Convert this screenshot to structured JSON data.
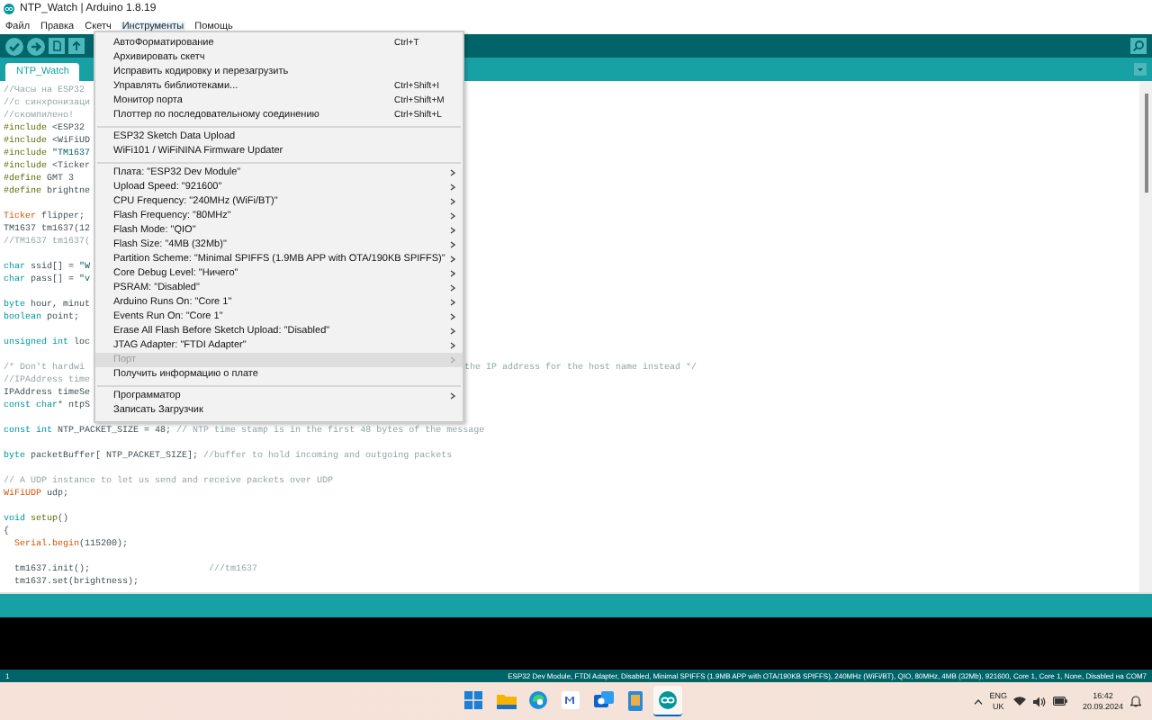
{
  "window": {
    "title": "NTP_Watch | Arduino 1.8.19"
  },
  "menu_bar": [
    {
      "label": "Файл",
      "selected": false
    },
    {
      "label": "Правка",
      "selected": false
    },
    {
      "label": "Скетч",
      "selected": false
    },
    {
      "label": "Инструменты",
      "selected": true
    },
    {
      "label": "Помощь",
      "selected": false
    }
  ],
  "tabs": [
    {
      "label": "NTP_Watch",
      "selected": true
    }
  ],
  "editor": {
    "lines": [
      {
        "kind": "code",
        "segments": [
          {
            "text": "//Часы на ESP32",
            "kind": "comment"
          }
        ]
      },
      {
        "kind": "code",
        "segments": [
          {
            "text": "//с синхронизаци",
            "kind": "comment"
          }
        ]
      },
      {
        "kind": "code",
        "segments": [
          {
            "text": "//скомпилено!",
            "kind": "comment"
          }
        ]
      },
      {
        "kind": "code",
        "segments": [
          {
            "text": "#include",
            "kind": "directive"
          },
          {
            "text": " <ESP32",
            "kind": "plain"
          }
        ]
      },
      {
        "kind": "code",
        "segments": [
          {
            "text": "#include",
            "kind": "directive"
          },
          {
            "text": " <WiFiUD",
            "kind": "plain"
          }
        ]
      },
      {
        "kind": "code",
        "segments": [
          {
            "text": "#include",
            "kind": "directive"
          },
          {
            "text": " \"TM1637",
            "kind": "string"
          }
        ]
      },
      {
        "kind": "code",
        "segments": [
          {
            "text": "#include",
            "kind": "directive"
          },
          {
            "text": " <Ticker",
            "kind": "plain"
          }
        ]
      },
      {
        "kind": "code",
        "segments": [
          {
            "text": "#define",
            "kind": "directive"
          },
          {
            "text": " GMT 3",
            "kind": "plain"
          }
        ]
      },
      {
        "kind": "code",
        "segments": [
          {
            "text": "#define",
            "kind": "directive"
          },
          {
            "text": " brightne",
            "kind": "plain"
          }
        ]
      },
      {
        "kind": "blank"
      },
      {
        "kind": "code",
        "segments": [
          {
            "text": "Ticker",
            "kind": "class"
          },
          {
            "text": " flipper;",
            "kind": "plain"
          }
        ]
      },
      {
        "kind": "code",
        "segments": [
          {
            "text": "TM1637 tm1637(12",
            "kind": "plain"
          }
        ]
      },
      {
        "kind": "code",
        "segments": [
          {
            "text": "//TM1637 tm1637(",
            "kind": "comment"
          }
        ]
      },
      {
        "kind": "blank"
      },
      {
        "kind": "code",
        "segments": [
          {
            "text": "char",
            "kind": "keyword"
          },
          {
            "text": " ssid[] = ",
            "kind": "plain"
          },
          {
            "text": "\"W",
            "kind": "string"
          }
        ]
      },
      {
        "kind": "code",
        "segments": [
          {
            "text": "char",
            "kind": "keyword"
          },
          {
            "text": " pass[] = ",
            "kind": "plain"
          },
          {
            "text": "\"v",
            "kind": "string"
          }
        ]
      },
      {
        "kind": "blank"
      },
      {
        "kind": "code",
        "segments": [
          {
            "text": "byte",
            "kind": "keyword"
          },
          {
            "text": " hour, minut",
            "kind": "plain"
          }
        ]
      },
      {
        "kind": "code",
        "segments": [
          {
            "text": "boolean",
            "kind": "keyword"
          },
          {
            "text": " point;",
            "kind": "plain"
          }
        ]
      },
      {
        "kind": "blank"
      },
      {
        "kind": "code",
        "segments": [
          {
            "text": "unsigned int",
            "kind": "keyword"
          },
          {
            "text": " loc",
            "kind": "plain"
          }
        ]
      },
      {
        "kind": "blank"
      },
      {
        "kind": "code",
        "segments": [
          {
            "text": "/* Don't hardwi",
            "kind": "comment"
          }
        ],
        "tail": "the IP address for the host name instead */"
      },
      {
        "kind": "code",
        "segments": [
          {
            "text": "//IPAddress time",
            "kind": "comment"
          }
        ]
      },
      {
        "kind": "code",
        "segments": [
          {
            "text": "IPAddress timeSe",
            "kind": "plain"
          }
        ]
      },
      {
        "kind": "code",
        "segments": [
          {
            "text": "const",
            "kind": "keyword"
          },
          {
            "text": " char",
            "kind": "keyword"
          },
          {
            "text": "* ntpS",
            "kind": "plain"
          }
        ]
      },
      {
        "kind": "blank"
      },
      {
        "kind": "code",
        "segments": [
          {
            "text": "const",
            "kind": "keyword"
          },
          {
            "text": " int",
            "kind": "keyword"
          },
          {
            "text": " NTP_PACKET_SIZE = 48; ",
            "kind": "plain"
          },
          {
            "text": "// NTP time stamp is in the first 48 bytes of the message",
            "kind": "comment"
          }
        ]
      },
      {
        "kind": "blank"
      },
      {
        "kind": "code",
        "segments": [
          {
            "text": "byte",
            "kind": "keyword"
          },
          {
            "text": " packetBuffer[ NTP_PACKET_SIZE]; ",
            "kind": "plain"
          },
          {
            "text": "//buffer to hold incoming and outgoing packets",
            "kind": "comment"
          }
        ]
      },
      {
        "kind": "blank"
      },
      {
        "kind": "code",
        "segments": [
          {
            "text": "// A UDP instance to let us send and receive packets over UDP",
            "kind": "comment"
          }
        ]
      },
      {
        "kind": "code",
        "segments": [
          {
            "text": "WiFiUDP",
            "kind": "class"
          },
          {
            "text": " udp;",
            "kind": "plain"
          }
        ]
      },
      {
        "kind": "blank"
      },
      {
        "kind": "code",
        "segments": [
          {
            "text": "void",
            "kind": "keyword"
          },
          {
            "text": " setup",
            "kind": "directive"
          },
          {
            "text": "()",
            "kind": "plain"
          }
        ]
      },
      {
        "kind": "code",
        "segments": [
          {
            "text": "{",
            "kind": "plain"
          }
        ]
      },
      {
        "kind": "code",
        "segments": [
          {
            "text": "  Serial",
            "kind": "class"
          },
          {
            "text": ".",
            "kind": "plain"
          },
          {
            "text": "begin",
            "kind": "class"
          },
          {
            "text": "(115200);",
            "kind": "plain"
          }
        ]
      },
      {
        "kind": "blank"
      },
      {
        "kind": "code",
        "segments": [
          {
            "text": "  tm1637.init();                      ",
            "kind": "plain"
          },
          {
            "text": "///tm1637",
            "kind": "comment"
          }
        ]
      },
      {
        "kind": "code",
        "segments": [
          {
            "text": "  tm1637.set(brightness);",
            "kind": "plain"
          }
        ]
      }
    ]
  },
  "tools_menu": [
    {
      "kind": "item",
      "label": "АвтоФорматирование",
      "shortcut": "Ctrl+T",
      "submenu": false,
      "disabled": false,
      "highlighted": false
    },
    {
      "kind": "item",
      "label": "Архивировать скетч",
      "submenu": false,
      "disabled": false,
      "highlighted": false
    },
    {
      "kind": "item",
      "label": "Исправить кодировку и перезагрузить",
      "submenu": false,
      "disabled": false,
      "highlighted": false
    },
    {
      "kind": "item",
      "label": "Управлять библиотеками...",
      "shortcut": "Ctrl+Shift+I",
      "submenu": false,
      "disabled": false,
      "highlighted": false
    },
    {
      "kind": "item",
      "label": "Монитор порта",
      "shortcut": "Ctrl+Shift+M",
      "submenu": false,
      "disabled": false,
      "highlighted": false
    },
    {
      "kind": "item",
      "label": "Плоттер по последовательному соединению",
      "shortcut": "Ctrl+Shift+L",
      "submenu": false,
      "disabled": false,
      "highlighted": false
    },
    {
      "kind": "separator"
    },
    {
      "kind": "item",
      "label": "ESP32 Sketch Data Upload",
      "submenu": false,
      "disabled": false,
      "highlighted": false
    },
    {
      "kind": "item",
      "label": "WiFi101 / WiFiNINA Firmware Updater",
      "submenu": false,
      "disabled": false,
      "highlighted": false
    },
    {
      "kind": "separator"
    },
    {
      "kind": "item",
      "label": "Плата: \"ESP32 Dev Module\"",
      "submenu": true,
      "disabled": false,
      "highlighted": false
    },
    {
      "kind": "item",
      "label": "Upload Speed: \"921600\"",
      "submenu": true,
      "disabled": false,
      "highlighted": false
    },
    {
      "kind": "item",
      "label": "CPU Frequency: \"240MHz (WiFi/BT)\"",
      "submenu": true,
      "disabled": false,
      "highlighted": false
    },
    {
      "kind": "item",
      "label": "Flash Frequency: \"80MHz\"",
      "submenu": true,
      "disabled": false,
      "highlighted": false
    },
    {
      "kind": "item",
      "label": "Flash Mode: \"QIO\"",
      "submenu": true,
      "disabled": false,
      "highlighted": false
    },
    {
      "kind": "item",
      "label": "Flash Size: \"4MB (32Mb)\"",
      "submenu": true,
      "disabled": false,
      "highlighted": false
    },
    {
      "kind": "item",
      "label": "Partition Scheme: \"Minimal SPIFFS (1.9MB APP with OTA/190KB SPIFFS)\"",
      "submenu": true,
      "disabled": false,
      "highlighted": false
    },
    {
      "kind": "item",
      "label": "Core Debug Level: \"Ничего\"",
      "submenu": true,
      "disabled": false,
      "highlighted": false
    },
    {
      "kind": "item",
      "label": "PSRAM: \"Disabled\"",
      "submenu": true,
      "disabled": false,
      "highlighted": false
    },
    {
      "kind": "item",
      "label": "Arduino Runs On: \"Core 1\"",
      "submenu": true,
      "disabled": false,
      "highlighted": false
    },
    {
      "kind": "item",
      "label": "Events Run On: \"Core 1\"",
      "submenu": true,
      "disabled": false,
      "highlighted": false
    },
    {
      "kind": "item",
      "label": "Erase All Flash Before Sketch Upload: \"Disabled\"",
      "submenu": true,
      "disabled": false,
      "highlighted": false
    },
    {
      "kind": "item",
      "label": "JTAG Adapter: \"FTDI Adapter\"",
      "submenu": true,
      "disabled": false,
      "highlighted": false
    },
    {
      "kind": "item",
      "label": "Порт",
      "submenu": true,
      "disabled": true,
      "highlighted": true
    },
    {
      "kind": "item",
      "label": "Получить информацию о плате",
      "submenu": false,
      "disabled": false,
      "highlighted": false
    },
    {
      "kind": "separator"
    },
    {
      "kind": "item",
      "label": "Программатор",
      "submenu": true,
      "disabled": false,
      "highlighted": false
    },
    {
      "kind": "item",
      "label": "Записать Загрузчик",
      "submenu": false,
      "disabled": false,
      "highlighted": false
    }
  ],
  "status_bar": {
    "line": "1",
    "board": "ESP32 Dev Module, FTDI Adapter, Disabled, Minimal SPIFFS (1.9MB APP with OTA/190KB SPIFFS), 240MHz (WiFi/BT), QIO, 80MHz, 4MB (32Mb), 921600, Core 1, Core 1, None, Disabled на COM7"
  },
  "taskbar": {
    "apps": [
      {
        "kind": "start",
        "selected": false
      },
      {
        "kind": "folder",
        "selected": false
      },
      {
        "kind": "browser",
        "selected": false
      },
      {
        "kind": "app",
        "selected": false
      },
      {
        "kind": "mail",
        "selected": false
      },
      {
        "kind": "notebook",
        "selected": false
      },
      {
        "kind": "arduino",
        "selected": true
      }
    ],
    "language": "ENG",
    "layout": "UK",
    "time": "16:42",
    "date": "20.09.2024"
  }
}
